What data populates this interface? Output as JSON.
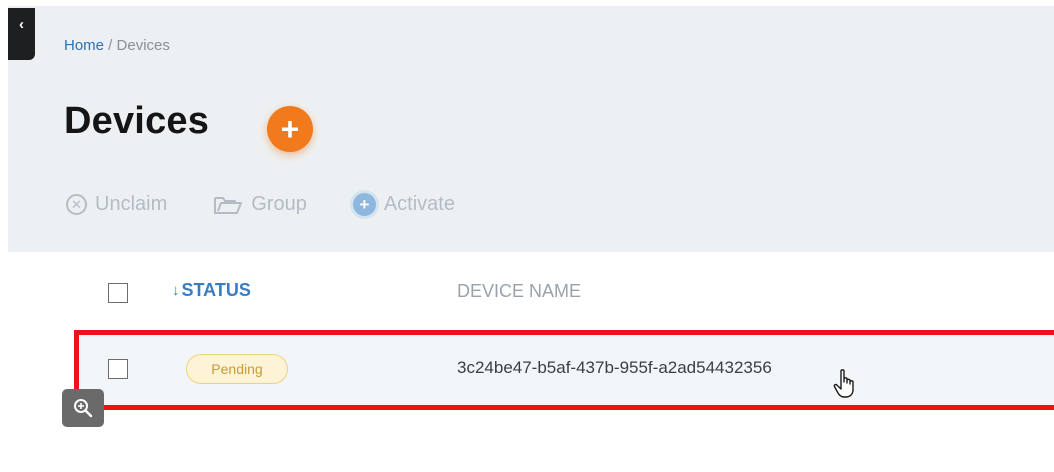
{
  "sidebar": {
    "collapse_glyph": "‹",
    "collapse_icon": "chevron-left-icon"
  },
  "breadcrumb": {
    "home": "Home",
    "separator": " / ",
    "current": "Devices"
  },
  "page": {
    "title": "Devices",
    "add_glyph": "+",
    "accent_color": "#f07a1c"
  },
  "toolbar": {
    "unclaim_label": "Unclaim",
    "unclaim_icon": "close-circle-icon",
    "group_label": "Group",
    "group_icon": "folder-open-icon",
    "activate_label": "Activate",
    "activate_icon": "plus-circle-icon"
  },
  "table": {
    "columns": [
      {
        "label": "STATUS",
        "sort": "descending",
        "sort_glyph": "↓"
      },
      {
        "label": "DEVICE NAME"
      }
    ],
    "rows": [
      {
        "status": "Pending",
        "device_name": "3c24be47-b5af-437b-955f-a2ad54432356",
        "selected": false
      }
    ]
  },
  "overlay": {
    "highlight_color": "#e8141a",
    "zoom_icon": "zoom-in-icon",
    "cursor_icon": "hand-pointer-icon"
  }
}
